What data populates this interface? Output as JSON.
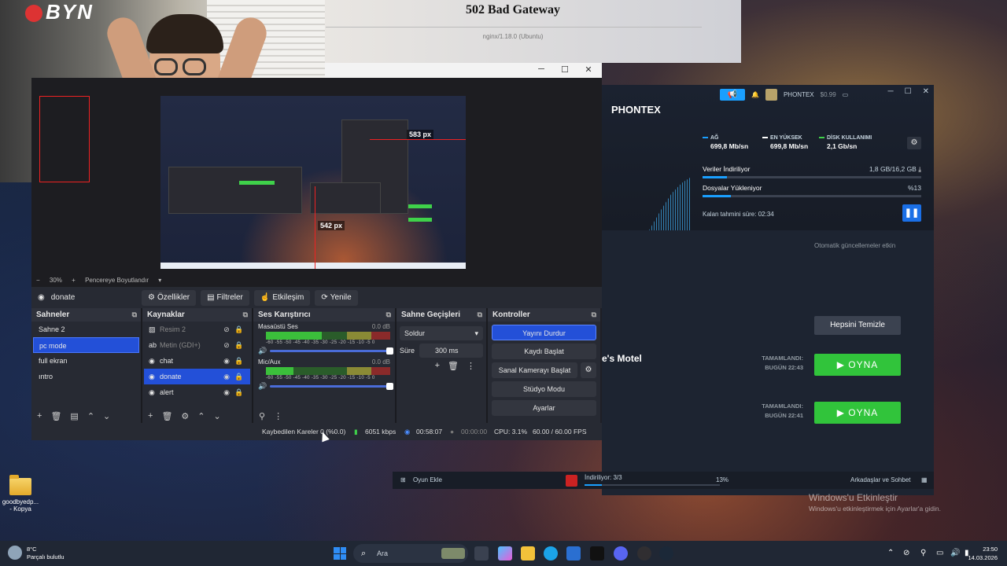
{
  "desktop": {
    "icon_label": "goodbyedp... - Kopya",
    "activate_title": "Windows'u Etkinleştir",
    "activate_sub": "Windows'u etkinleştirmek için Ayarlar'a gidin."
  },
  "browser_error": {
    "title": "502 Bad Gateway",
    "subtitle": "nginx/1.18.0 (Ubuntu)"
  },
  "webcam": {
    "logo": "BYN"
  },
  "obs": {
    "preview": {
      "label_1": "583 px",
      "label_2": "542 px"
    },
    "zoom_row": {
      "zoom": "30%",
      "fit": "Pencereye Boyutlandır"
    },
    "current_scene": "donate",
    "toolbar": {
      "properties": "Özellikler",
      "filters": "Filtreler",
      "interact": "Etkileşim",
      "refresh": "Yenile"
    },
    "scenes": {
      "title": "Sahneler",
      "items": [
        {
          "label": "Sahne 2",
          "selected": false
        },
        {
          "label": "pc mode",
          "selected": true
        },
        {
          "label": "full ekran",
          "selected": false
        },
        {
          "label": "ıntro",
          "selected": false
        }
      ]
    },
    "sources": {
      "title": "Kaynaklar",
      "items": [
        {
          "label": "Resim 2",
          "icon": "image-icon",
          "hidden": true
        },
        {
          "label": "Metin (GDI+)",
          "icon": "text-icon",
          "hidden": true
        },
        {
          "label": "chat",
          "icon": "browser-icon",
          "hidden": false
        },
        {
          "label": "donate",
          "icon": "browser-icon",
          "hidden": false,
          "selected": true
        },
        {
          "label": "alert",
          "icon": "browser-icon",
          "hidden": false
        }
      ]
    },
    "mixer": {
      "title": "Ses Karıştırıcı",
      "scale": "-60 -55 -50 -45 -40 -35 -30 -25 -20 -15 -10 -5 0",
      "channels": [
        {
          "name": "Masaüstü Ses",
          "db": "0.0 dB",
          "level": 0.45
        },
        {
          "name": "Mic/Aux",
          "db": "0.0 dB",
          "level": 0.22
        }
      ]
    },
    "transitions": {
      "title": "Sahne Geçişleri",
      "type": "Soldur",
      "duration_label": "Süre",
      "duration": "300 ms"
    },
    "controls": {
      "title": "Kontroller",
      "stop_stream": "Yayını Durdur",
      "start_record": "Kaydı Başlat",
      "virtual_cam": "Sanal Kamerayı Başlat",
      "studio_mode": "Stüdyo Modu",
      "settings": "Ayarlar"
    },
    "status": {
      "dropped": "Kaybedilen Kareler 0 (%0.0)",
      "bitrate": "6051 kbps",
      "live_time": "00:58:07",
      "rec_time": "00:00:00",
      "cpu": "CPU: 3.1%",
      "fps": "60.00 / 60.00 FPS"
    }
  },
  "steam": {
    "account": "PHONTEX",
    "balance": "$0.99",
    "title": "PHONTEX",
    "stats": [
      {
        "label": "AĞ",
        "value": "699,8 Mb/sn",
        "color": "#1a9fff"
      },
      {
        "label": "EN YÜKSEK",
        "value": "699,8 Mb/sn",
        "color": "#ffffff"
      },
      {
        "label": "DİSK KULLANIMI",
        "value": "2,1 Gb/sn",
        "color": "#3fd14a"
      }
    ],
    "download": {
      "label": "Veriler İndiriliyor",
      "progress": "1,8 GB/16,2 GB",
      "fraction": 0.11
    },
    "upload": {
      "label": "Dosyalar Yükleniyor",
      "percent": "%13",
      "fraction": 0.13
    },
    "eta": "Kalan tahmini süre: 02:34",
    "auto_updates": "Otomatik güncellemeler etkin",
    "clear_all": "Hepsini Temizle",
    "game_name": "e's Motel",
    "completed": [
      {
        "line1": "TAMAMLANDI:",
        "line2": "BUGÜN 22:43",
        "play": "OYNA"
      },
      {
        "line1": "TAMAMLANDI:",
        "line2": "BUGÜN 22:41",
        "play": "OYNA"
      }
    ],
    "footer": {
      "add_game": "Oyun Ekle",
      "downloading": "İndiriliyor: 3/3",
      "percent": "13%",
      "friends": "Arkadaşlar ve Sohbet"
    }
  },
  "taskbar": {
    "weather_temp": "8°C",
    "weather_desc": "Parçalı bulutlu",
    "search": "Ara",
    "time": "23:50",
    "date": "14.03.2026"
  }
}
